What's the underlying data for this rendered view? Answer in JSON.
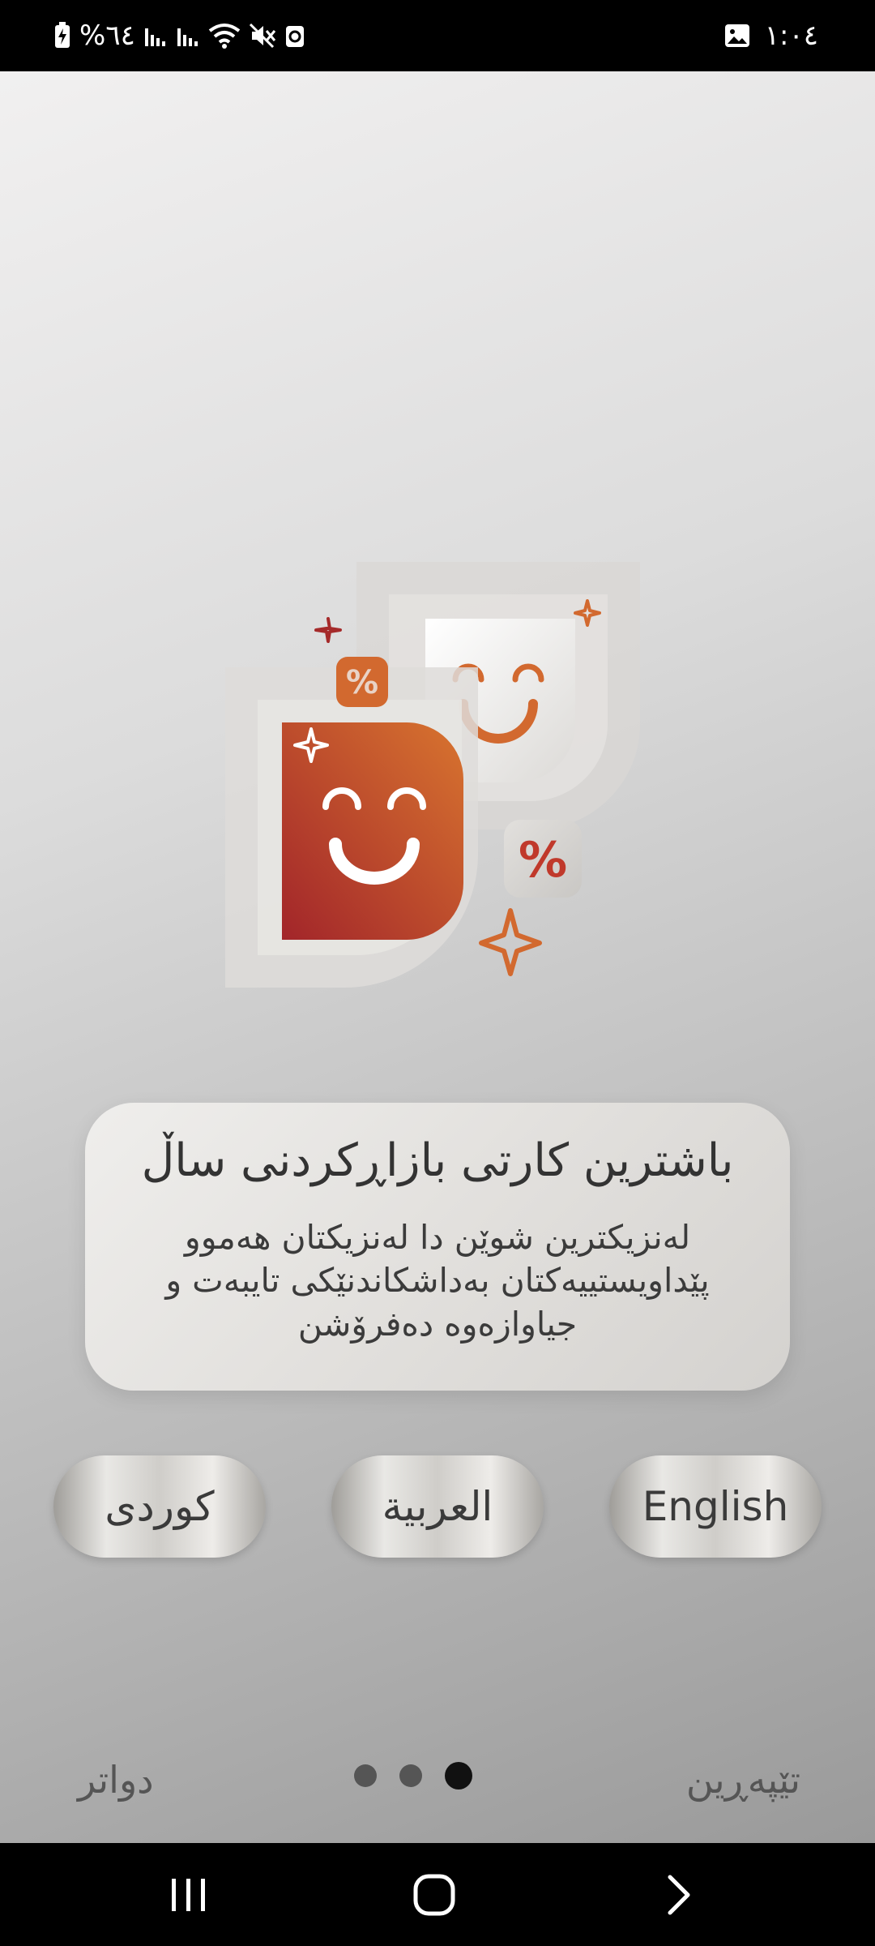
{
  "status_bar": {
    "battery_text": "%٦٤",
    "time": "١:٠٤"
  },
  "hero": {
    "percent_small": "%",
    "percent_large": "%"
  },
  "card": {
    "title": "باشترین کارتی بازاڕکردنی ساڵ",
    "description": "لەنزیکترین شوێن دا لەنزیکتان هەموو پێداویستییەکتان بەداشکاندنێکی تایبەت و جیاوازەوە دەفرۆشن"
  },
  "languages": {
    "kurdish": "کوردی",
    "arabic": "العربية",
    "english": "English"
  },
  "nav": {
    "next_label": "دواتر",
    "skip_label": "تێپەڕین",
    "pages": 3,
    "current_page": 3
  },
  "colors": {
    "accent_orange": "#d2692f",
    "accent_red": "#a52a2a"
  }
}
